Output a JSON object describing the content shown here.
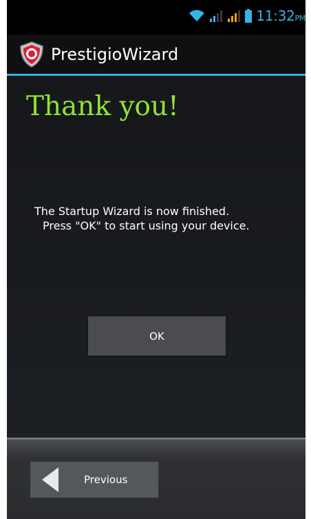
{
  "status_bar": {
    "time": "11:32",
    "ampm": "PM"
  },
  "action_bar": {
    "title": "PrestigioWizard",
    "logo": "prestigio-logo-icon"
  },
  "content": {
    "heading": "Thank you!",
    "message_line1": "The Startup Wizard is now finished.",
    "message_line2": "Press \"OK\" to start using your device.",
    "ok_label": "OK"
  },
  "bottom_bar": {
    "previous_label": "Previous",
    "previous_icon": "triangle-left-icon"
  },
  "colors": {
    "accent": "#33b5e5",
    "heading": "#8fe334",
    "background": "#111316"
  }
}
